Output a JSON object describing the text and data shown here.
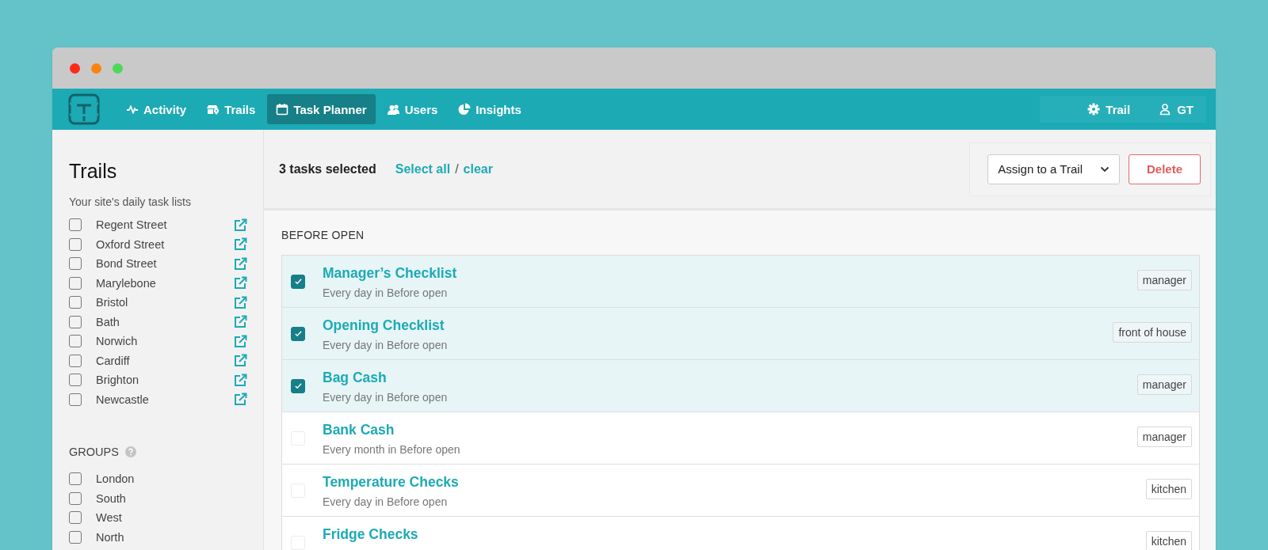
{
  "nav": {
    "items": [
      {
        "label": "Activity",
        "kind": "activity",
        "selected": false
      },
      {
        "label": "Trails",
        "kind": "trails",
        "selected": false
      },
      {
        "label": "Task Planner",
        "kind": "planner",
        "selected": true
      },
      {
        "label": "Users",
        "kind": "users",
        "selected": false
      },
      {
        "label": "Insights",
        "kind": "insights",
        "selected": false
      }
    ],
    "right": [
      {
        "label": "Trail",
        "kind": "settings"
      },
      {
        "label": "GT",
        "kind": "user"
      }
    ]
  },
  "sidebar": {
    "title": "Trails",
    "subtitle": "Your site's daily task lists",
    "trails": [
      {
        "label": "Regent Street",
        "checked": false
      },
      {
        "label": "Oxford Street",
        "checked": false
      },
      {
        "label": "Bond Street",
        "checked": false
      },
      {
        "label": "Marylebone",
        "checked": false
      },
      {
        "label": "Bristol",
        "checked": false
      },
      {
        "label": "Bath",
        "checked": false
      },
      {
        "label": "Norwich",
        "checked": false
      },
      {
        "label": "Cardiff",
        "checked": false
      },
      {
        "label": "Brighton",
        "checked": false
      },
      {
        "label": "Newcastle",
        "checked": false
      }
    ],
    "groups_heading": "GROUPS",
    "groups": [
      {
        "label": "London",
        "checked": false
      },
      {
        "label": "South",
        "checked": false
      },
      {
        "label": "West",
        "checked": false
      },
      {
        "label": "North",
        "checked": false
      }
    ]
  },
  "selection": {
    "count": "3 tasks selected",
    "select_all": "Select all",
    "separator": "/",
    "clear": "clear",
    "assign": "Assign to a Trail",
    "delete": "Delete"
  },
  "section": {
    "heading": "BEFORE OPEN",
    "tasks": [
      {
        "title": "Manager’s Checklist",
        "schedule": "Every day in Before open",
        "tag": "manager",
        "checked": true
      },
      {
        "title": "Opening Checklist",
        "schedule": "Every day in Before open",
        "tag": "front of house",
        "checked": true
      },
      {
        "title": "Bag Cash",
        "schedule": "Every day in Before open",
        "tag": "manager",
        "checked": true
      },
      {
        "title": "Bank Cash",
        "schedule": "Every month in Before open",
        "tag": "manager",
        "checked": false
      },
      {
        "title": "Temperature Checks",
        "schedule": "Every day in Before open",
        "tag": "kitchen",
        "checked": false
      },
      {
        "title": "Fridge Checks",
        "tag": "kitchen",
        "checked": false
      }
    ]
  }
}
